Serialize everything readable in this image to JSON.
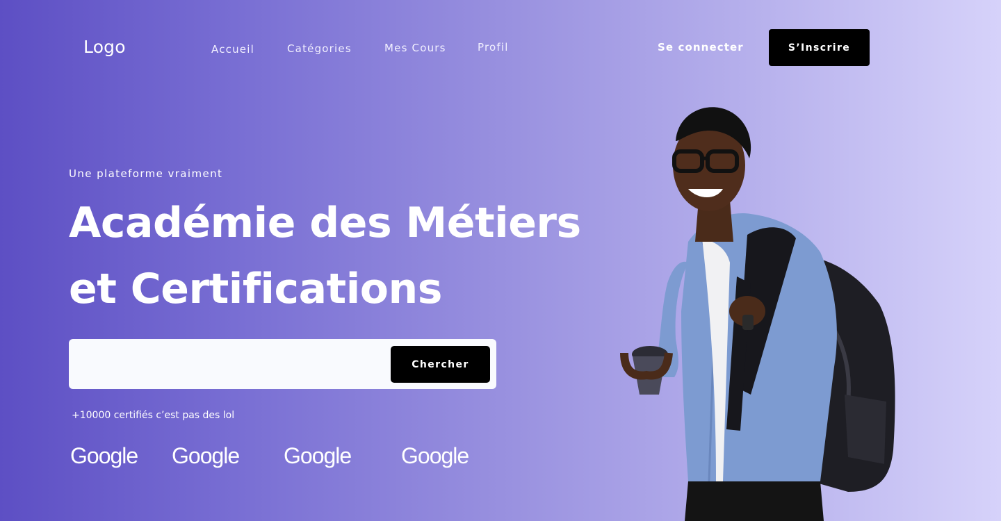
{
  "header": {
    "logo": "Logo",
    "nav": [
      "Accueil",
      "Catégories",
      "Mes Cours",
      "Profil"
    ],
    "login_label": "Se connecter",
    "signup_label": "S’Inscrire"
  },
  "hero": {
    "eyebrow": "Une plateforme vraiment",
    "title_line1": "Académie des Métiers",
    "title_line2": "et Certifications",
    "search": {
      "value": "",
      "placeholder": "",
      "button_label": "Chercher"
    },
    "social_proof": "+10000 certifiés c’est pas des lol",
    "partners": [
      "Google",
      "Google",
      "Google",
      "Google"
    ]
  },
  "colors": {
    "gradient_start": "#5d4fc4",
    "gradient_end": "#d6d2fa",
    "button": "#000000",
    "search_bg": "#f9fafe"
  },
  "icons": [
    "student-photo"
  ]
}
